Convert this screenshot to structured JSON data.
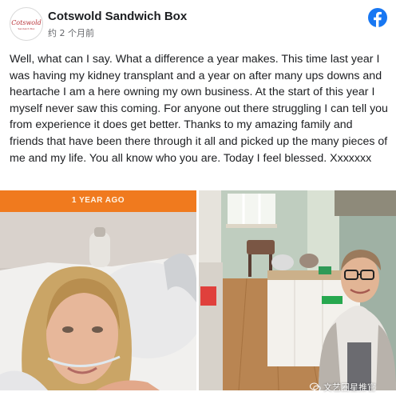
{
  "page": {
    "name": "Cotswold Sandwich Box",
    "timestamp": "约 2 个月前",
    "logo_text": "Cotswold",
    "logo_subtext": "Sandwich Box"
  },
  "post": {
    "text": "Well, what can I say. What a difference a year makes. This time last year I was having my kidney transplant and a year on after many ups downs and heartache I am a here owning my own business. At the start of this year I myself never saw this coming. For anyone out there struggling I can tell you from experience it does get better. Thanks to my amazing family and friends that have been there through it all and picked up the many pieces of me and my life. You all know who you are. Today I feel blessed. Xxxxxxx"
  },
  "photos": {
    "left_banner": "1 YEAR AGO"
  },
  "watermark": {
    "text": "文艺圈星推官"
  },
  "colors": {
    "facebook_blue": "#1877f2",
    "banner_orange": "#f07a1e"
  },
  "icons": {
    "platform": "facebook-icon",
    "watermark": "wechat-icon"
  }
}
